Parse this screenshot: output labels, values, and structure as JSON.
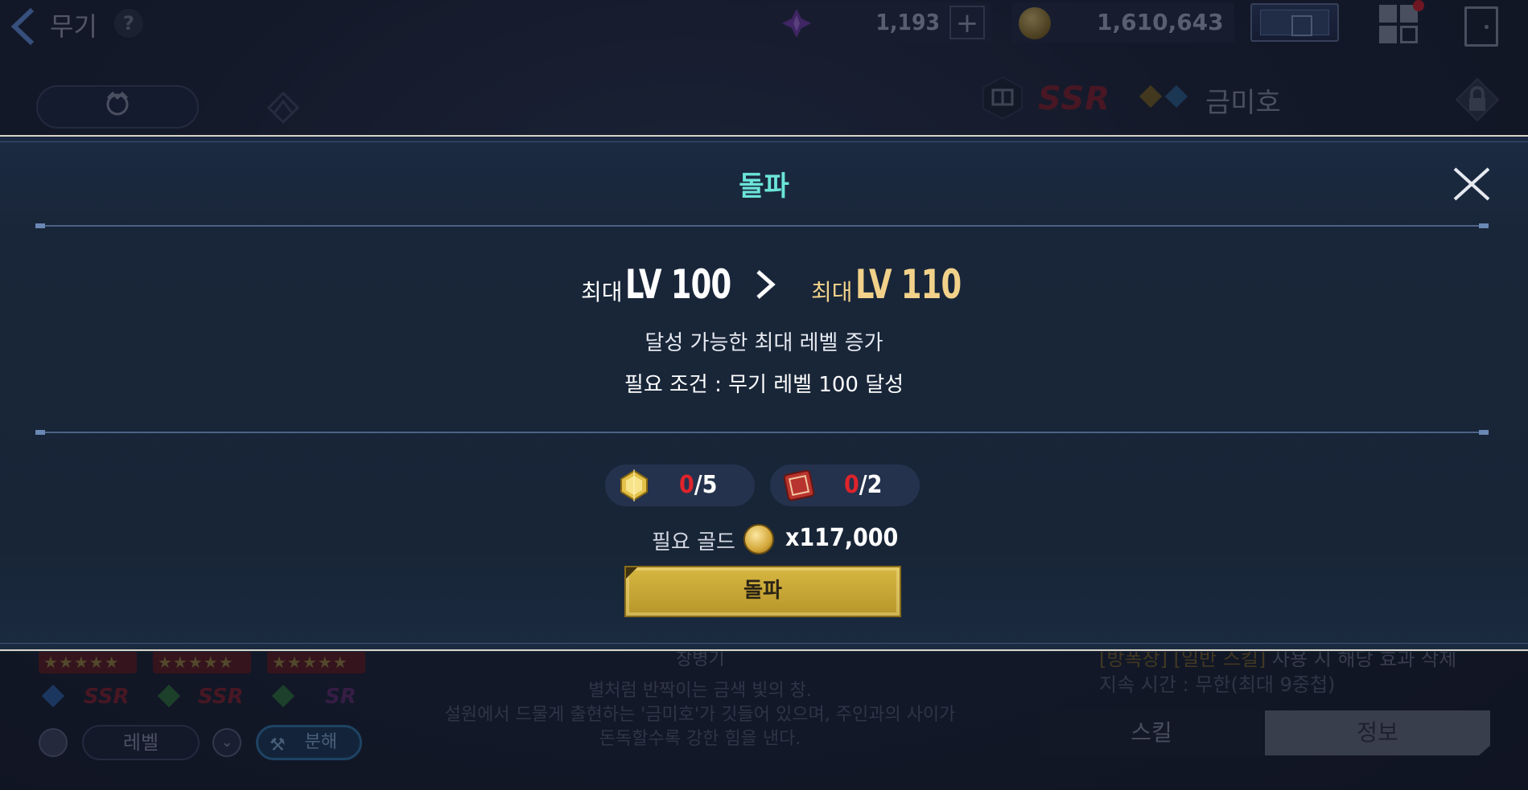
{
  "topbar": {
    "title": "무기",
    "help": "?",
    "gems": "1,193",
    "gems_plus": "+",
    "gold": "1,610,643"
  },
  "weapon_header": {
    "rarity": "SSR",
    "name": "금미호"
  },
  "bottom_panel": {
    "grades": [
      "SSR",
      "SSR",
      "SR"
    ],
    "sort_label": "레벨",
    "dismantle_label": "분해",
    "weapon_type": "창병기",
    "description": [
      "별처럼 반짝이는 금색 빛의 창.",
      "설원에서 드물게 출현하는 '금미호'가 깃들어 있으며, 주인과의 사이가",
      "돈독할수록 강한 힘을 낸다."
    ],
    "skill_line_1_tag": "[방폭장] [일반 스킬]",
    "skill_line_1_rest": " 사용 시 해당 효과 삭제",
    "skill_line_2": "지속 시간 : 무한(최대 9중첩)",
    "tab_skill": "스킬",
    "tab_info": "정보"
  },
  "modal": {
    "title": "돌파",
    "current_prefix": "최대",
    "current_level": "LV 100",
    "next_prefix": "최대",
    "next_level": "LV 110",
    "description": "달성 가능한 최대 레벨 증가",
    "condition": "필요 조건 : 무기 레벨 100 달성",
    "materials": [
      {
        "icon": "gold-crystal-icon",
        "have": "0",
        "need": "/5"
      },
      {
        "icon": "red-scroll-icon",
        "have": "0",
        "need": "/2"
      }
    ],
    "gold_label": "필요 골드",
    "gold_amount": "x117,000",
    "button_label": "돌파"
  },
  "colors": {
    "title_accent": "#6be4d8",
    "next_level": "#f2d28a",
    "missing_count": "#e0232b",
    "button_gold": "#d7b742"
  }
}
